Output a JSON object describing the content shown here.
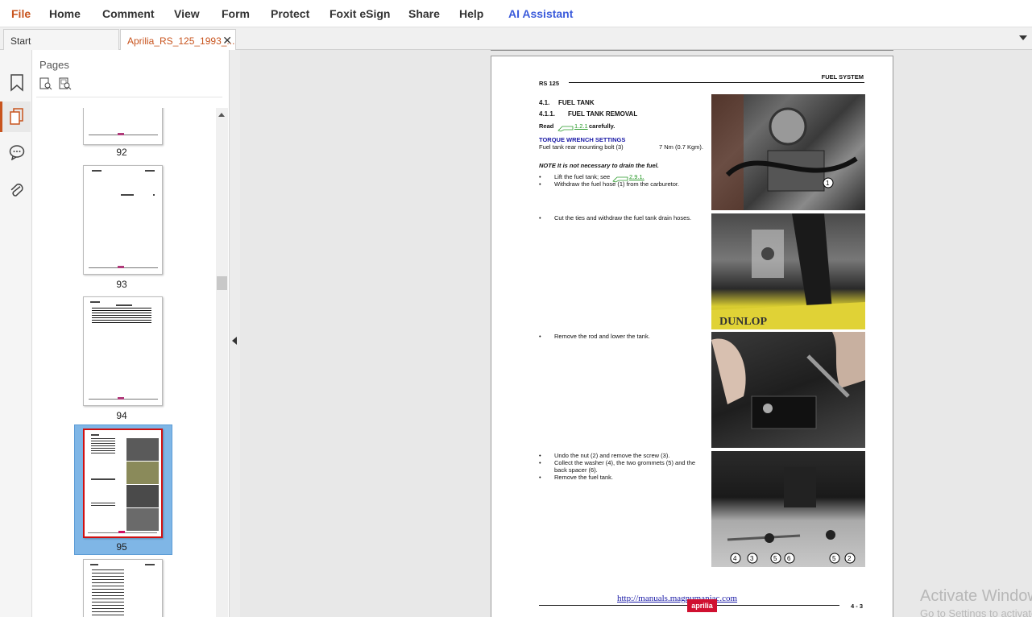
{
  "menu": {
    "file": "File",
    "home": "Home",
    "comment": "Comment",
    "view": "View",
    "form": "Form",
    "protect": "Protect",
    "esign": "Foxit eSign",
    "share": "Share",
    "help": "Help",
    "ai": "AI Assistant"
  },
  "tabs": {
    "start": "Start",
    "doc": "Aprilia_RS_125_1993_..."
  },
  "panel": {
    "title": "Pages",
    "pages": [
      "92",
      "93",
      "94",
      "95"
    ]
  },
  "page": {
    "header_left": "RS 125",
    "header_right": "FUEL SYSTEM",
    "sec": "4.1.",
    "sec_title": "FUEL TANK",
    "subsec": "4.1.1.",
    "subsec_title": "FUEL TANK REMOVAL",
    "read": "Read",
    "read_ref": "1.2.1",
    "read_tail": "carefully.",
    "torque_title": "TORQUE WRENCH SETTINGS",
    "torque_item": "Fuel tank rear mounting bolt (3)",
    "torque_value": "7 Nm (0.7 Kgm).",
    "note": "NOTE It is not necessary to drain the fuel.",
    "step1a": "Lift the fuel tank; see",
    "step1a_ref": "2.9.1.",
    "step1b": "Withdraw the fuel hose (1) from the carburetor.",
    "step2": "Cut the ties and withdraw the fuel tank drain hoses.",
    "step3": "Remove the rod and lower the tank.",
    "step4a": "Undo the nut (2) and remove the screw (3).",
    "step4b": "Collect the washer (4), the two grommets (5) and the",
    "step4b2": "back spacer (6).",
    "step4c": "Remove the fuel tank.",
    "callout1": "1",
    "callouts4": [
      "4",
      "3",
      "5",
      "6",
      "5",
      "2"
    ],
    "footer_url": "http://manuals.magnumaniac.com",
    "footer_logo": "aprilia",
    "footer_page": "4 - 3"
  },
  "watermark": {
    "line1": "Activate Windows",
    "line2": "Go to Settings to activate Windows."
  },
  "colors": {
    "accent": "#c8541e",
    "ai": "#3b5bdb",
    "selection": "#7fb6e6",
    "link": "#1a1aa6"
  }
}
